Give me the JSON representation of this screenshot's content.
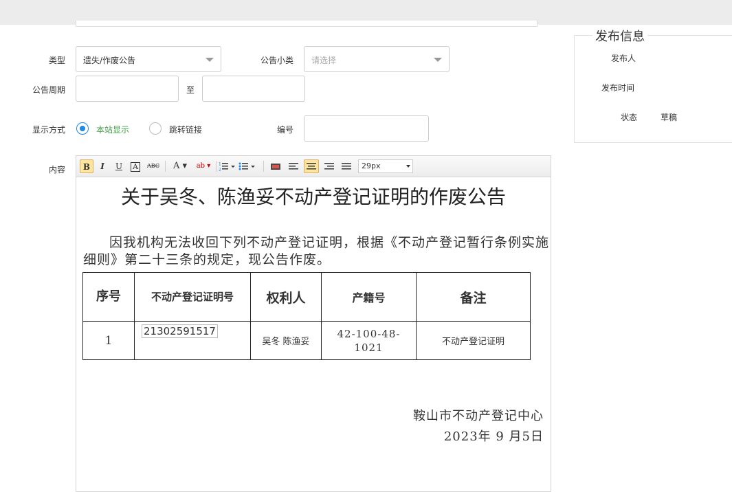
{
  "form": {
    "type_label": "类型",
    "type_value": "遗失/作废公告",
    "subtype_label": "公告小类",
    "subtype_placeholder": "请选择",
    "period_label": "公告周期",
    "period_sep": "至",
    "display_label": "显示方式",
    "display_opt_local": "本站显示",
    "display_opt_link": "跳转链接",
    "number_label": "编号",
    "content_label": "内容"
  },
  "side": {
    "title": "发布信息",
    "publisher_label": "发布人",
    "time_label": "发布时间",
    "status_label": "状态",
    "status_value": "草稿"
  },
  "toolbar": {
    "bold": "B",
    "italic": "I",
    "underline": "U",
    "border": "A",
    "strike": "ABC",
    "fontcolor": "A ▾",
    "highlight": "ab ▾",
    "fontsize": "29px"
  },
  "document": {
    "title": "关于吴冬、陈渔妥不动产登记证明的作废公告",
    "paragraph": "因我机构无法收回下列不动产登记证明，根据《不动产登记暂行条例实施细则》第二十三条的规定，现公告作废。",
    "headers": [
      "序号",
      "不动产登记证明号",
      "权利人",
      "产籍号",
      "备注"
    ],
    "row": [
      "1",
      "21302591517",
      "吴冬 陈渔妥",
      "42-100-48-1021",
      "不动产登记证明"
    ],
    "org": "鞍山市不动产登记中心",
    "date": "2023年 9 月5日"
  },
  "colors": {
    "accent": "#1e88e5",
    "active_tool": "#ffe69f",
    "topbar": "#ececec"
  }
}
